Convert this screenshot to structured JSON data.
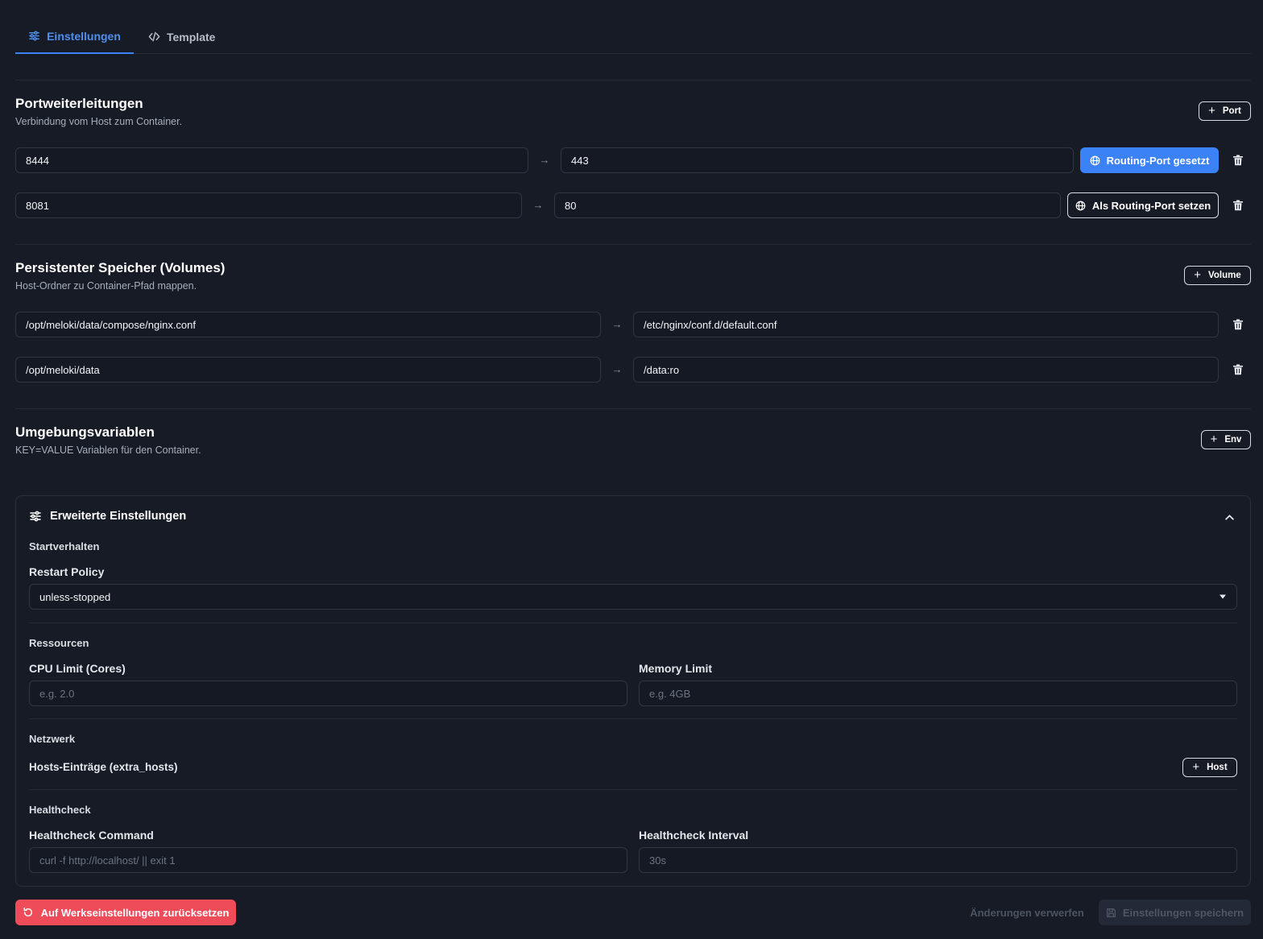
{
  "tabs": [
    {
      "label": "Einstellungen",
      "icon": "sliders-icon",
      "active": true
    },
    {
      "label": "Template",
      "icon": "code-icon",
      "active": false
    }
  ],
  "ports": {
    "title": "Portweiterleitungen",
    "subtitle": "Verbindung vom Host zum Container.",
    "add_label": "Port",
    "rows": [
      {
        "host": "8444",
        "container": "443",
        "routing_label": "Routing-Port gesetzt",
        "is_routing": true
      },
      {
        "host": "8081",
        "container": "80",
        "routing_label": "Als Routing-Port setzen",
        "is_routing": false
      }
    ]
  },
  "volumes": {
    "title": "Persistenter Speicher (Volumes)",
    "subtitle": "Host-Ordner zu Container-Pfad mappen.",
    "add_label": "Volume",
    "rows": [
      {
        "host": "/opt/meloki/data/compose/nginx.conf",
        "container": "/etc/nginx/conf.d/default.conf"
      },
      {
        "host": "/opt/meloki/data",
        "container": "/data:ro"
      }
    ]
  },
  "env": {
    "title": "Umgebungsvariablen",
    "subtitle": "KEY=VALUE Variablen für den Container.",
    "add_label": "Env"
  },
  "advanced": {
    "title": "Erweiterte Einstellungen",
    "start": {
      "group": "Startverhalten",
      "restart_label": "Restart Policy",
      "restart_value": "unless-stopped"
    },
    "resources": {
      "group": "Ressourcen",
      "cpu_label": "CPU Limit (Cores)",
      "cpu_placeholder": "e.g. 2.0",
      "memory_label": "Memory Limit",
      "memory_placeholder": "e.g. 4GB"
    },
    "network": {
      "group": "Netzwerk",
      "hosts_label": "Hosts-Einträge (extra_hosts)",
      "add_label": "Host"
    },
    "healthcheck": {
      "group": "Healthcheck",
      "command_label": "Healthcheck Command",
      "command_placeholder": "curl -f http://localhost/ || exit 1",
      "interval_label": "Healthcheck Interval",
      "interval_placeholder": "30s"
    }
  },
  "footer": {
    "reset_label": "Auf Werkseinstellungen zurücksetzen",
    "discard_label": "Änderungen verwerfen",
    "save_label": "Einstellungen speichern"
  },
  "colors": {
    "background": "#161b25",
    "accent": "#3b82f6",
    "danger": "#ef4c5a"
  }
}
